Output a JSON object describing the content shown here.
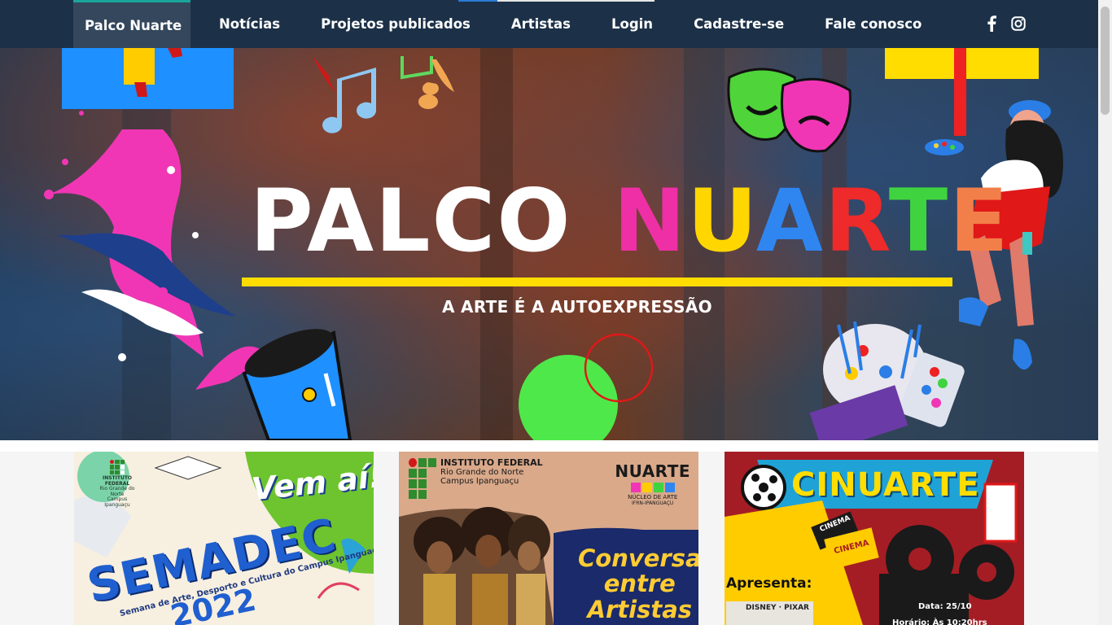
{
  "nav": {
    "items": [
      {
        "label": "Palco Nuarte",
        "active": true
      },
      {
        "label": "Notícias"
      },
      {
        "label": "Projetos publicados"
      },
      {
        "label": "Artistas"
      },
      {
        "label": "Login"
      },
      {
        "label": "Cadastre-se"
      },
      {
        "label": "Fale conosco"
      }
    ],
    "social": [
      "facebook-icon",
      "instagram-icon"
    ]
  },
  "hero": {
    "title_part1": "PALCO",
    "title_part2_letters": [
      {
        "ch": "N",
        "color": "#ee2fa5"
      },
      {
        "ch": "U",
        "color": "#ffd600"
      },
      {
        "ch": "A",
        "color": "#2f86f0"
      },
      {
        "ch": "R",
        "color": "#ef2a2a"
      },
      {
        "ch": "T",
        "color": "#3fd43f"
      },
      {
        "ch": "E",
        "color": "#f27f4a"
      }
    ],
    "subtitle": "A ARTE É A AUTOEXPRESSÃO"
  },
  "cards": [
    {
      "header": "INSTITUTO FEDERAL",
      "sub1": "Rio Grande do Norte",
      "sub2": "Campus Ipanguaçu",
      "tag": "Vem aí!",
      "title": "SEMADEC",
      "subtitle": "Semana de Arte, Desporto e Cultura do Campus Ipanguaçu",
      "year": "2022"
    },
    {
      "header": "INSTITUTO FEDERAL",
      "sub1": "Rio Grande do Norte",
      "sub2": "Campus Ipanguaçu",
      "logo": "NUARTE",
      "logo_sub1": "NÚCLEO DE ARTE",
      "logo_sub2": "IFRN-IPANGUAÇU",
      "title_lines": [
        "Conversa",
        "entre",
        "Artistas"
      ]
    },
    {
      "title": "CINUARTE",
      "ticket1": "CINEMA",
      "ticket2": "CINEMA",
      "presents": "Apresenta:",
      "studio": "DISNEY · PIXAR",
      "date": "Data: 25/10",
      "time": "Horário: Às 10:20hrs"
    }
  ],
  "colors": {
    "navbar": "#1c3148",
    "accent": "#1aa59b",
    "hero_bar": "#ffdd00"
  }
}
